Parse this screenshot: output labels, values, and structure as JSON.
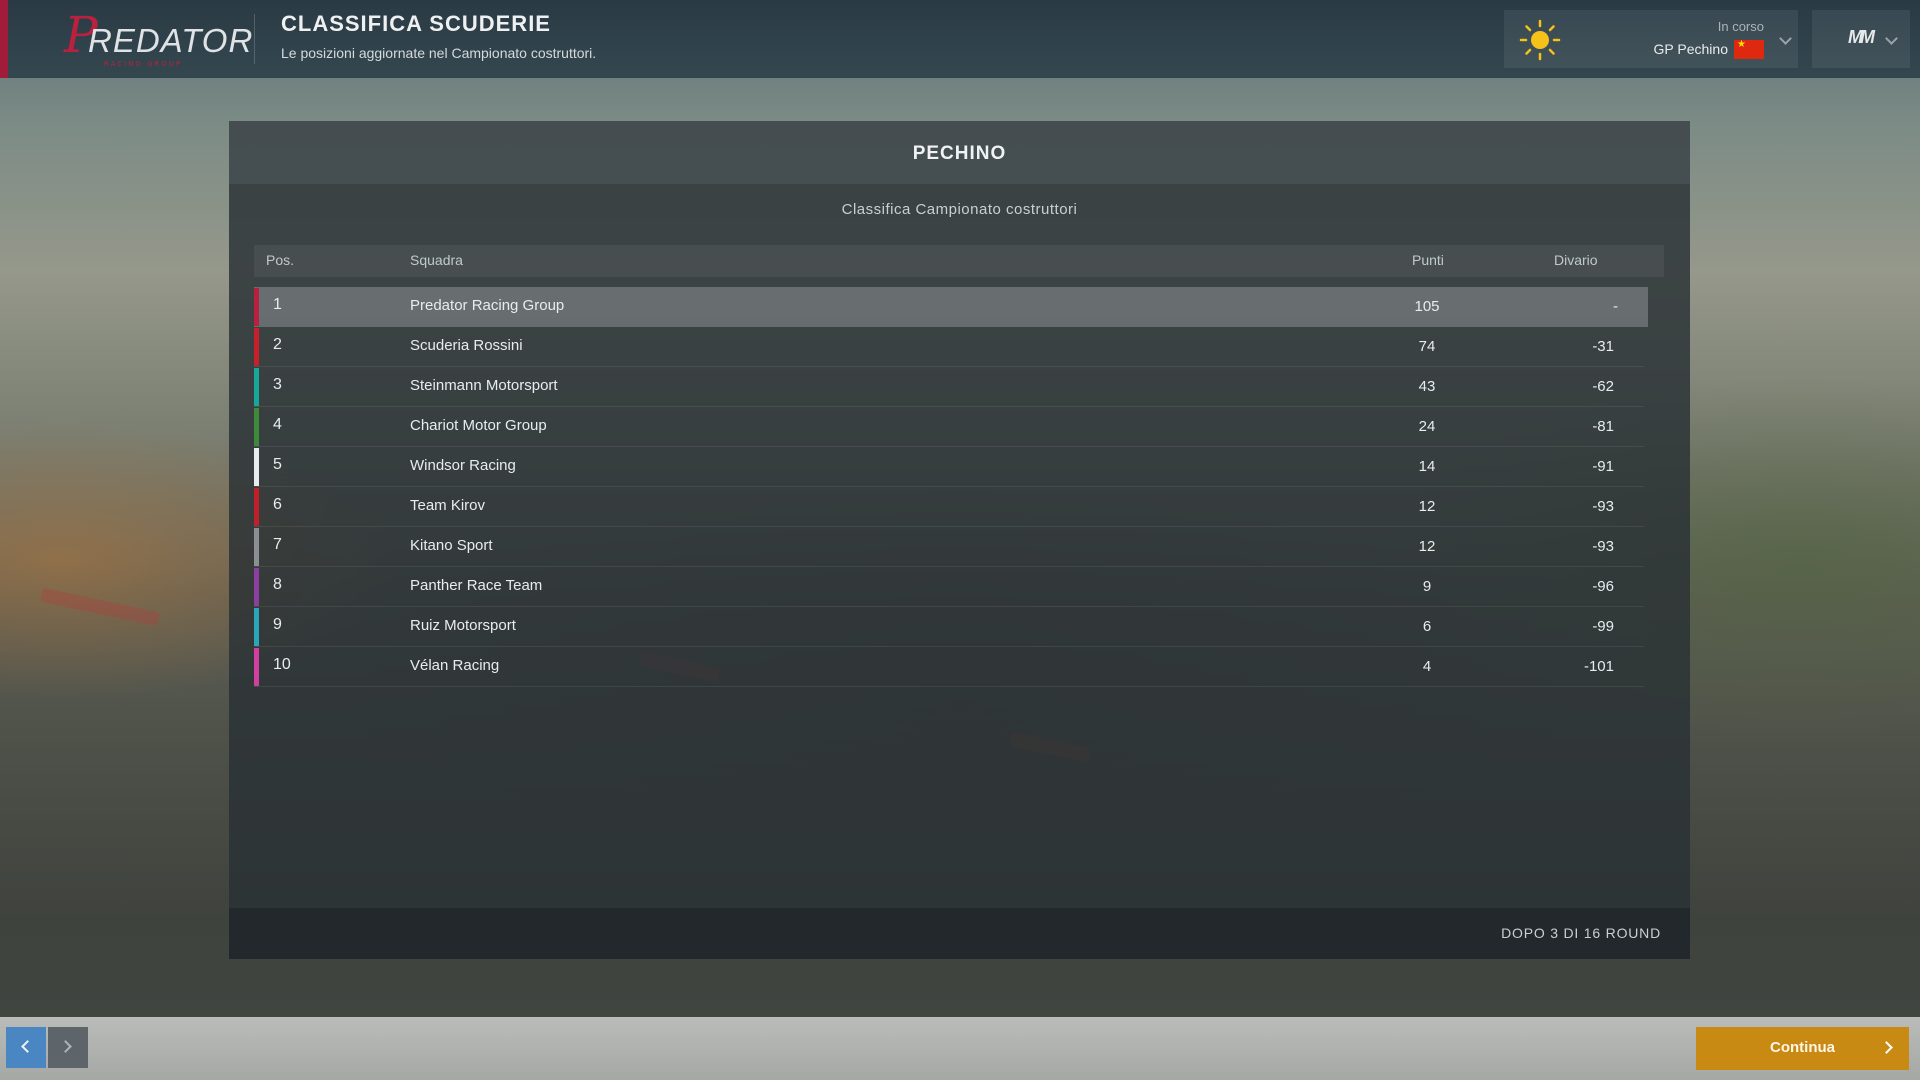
{
  "header": {
    "logo_text": "PREDATOR",
    "title": "CLASSIFICA SCUDERIE",
    "subtitle": "Le posizioni aggiornate nel Campionato costruttori.",
    "race_status": "In corso",
    "race_name": "GP Pechino",
    "weather_icon": "sun-icon",
    "flag_icon": "china-flag-icon",
    "game_logo": "MM"
  },
  "panel": {
    "title": "PECHINO",
    "subtitle": "Classifica Campionato costruttori",
    "columns": {
      "pos": "Pos.",
      "team": "Squadra",
      "points": "Punti",
      "gap": "Divario"
    },
    "rows": [
      {
        "pos": "1",
        "team": "Predator Racing Group",
        "points": "105",
        "gap": "-",
        "color": "#b91f3e"
      },
      {
        "pos": "2",
        "team": "Scuderia Rossini",
        "points": "74",
        "gap": "-31",
        "color": "#c8202a"
      },
      {
        "pos": "3",
        "team": "Steinmann Motorsport",
        "points": "43",
        "gap": "-62",
        "color": "#19a79b"
      },
      {
        "pos": "4",
        "team": "Chariot Motor Group",
        "points": "24",
        "gap": "-81",
        "color": "#3f8a3a"
      },
      {
        "pos": "5",
        "team": "Windsor Racing",
        "points": "14",
        "gap": "-91",
        "color": "#e8ecee"
      },
      {
        "pos": "6",
        "team": "Team Kirov",
        "points": "12",
        "gap": "-93",
        "color": "#c0202a"
      },
      {
        "pos": "7",
        "team": "Kitano Sport",
        "points": "12",
        "gap": "-93",
        "color": "#8a8f93"
      },
      {
        "pos": "8",
        "team": "Panther Race Team",
        "points": "9",
        "gap": "-96",
        "color": "#8b3fa0"
      },
      {
        "pos": "9",
        "team": "Ruiz Motorsport",
        "points": "6",
        "gap": "-99",
        "color": "#2aa6b8"
      },
      {
        "pos": "10",
        "team": "Vélan Racing",
        "points": "4",
        "gap": "-101",
        "color": "#d040a0"
      }
    ],
    "round_info": "DOPO 3 DI 16 ROUND"
  },
  "footer": {
    "continue_label": "Continua",
    "accent": "#c98a14",
    "nav_prev_color": "#4a86c2"
  }
}
